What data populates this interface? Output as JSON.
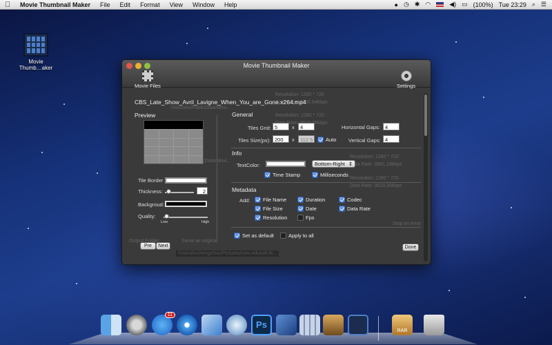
{
  "menubar": {
    "app_name": "Movie Thumbnail Maker",
    "menus": [
      "File",
      "Edit",
      "Format",
      "View",
      "Window",
      "Help"
    ],
    "battery": "(100%)",
    "clock": "Tue 23:29"
  },
  "desktop": {
    "icon_label": "Movie\nThumb…aker"
  },
  "window": {
    "title": "Movie Thumbnail Maker",
    "toolbar": {
      "movie_files": "Movie Files",
      "settings": "Settings"
    },
    "filename": "CBS_Late_Show_Avril_Lavigne_When_You_are_Gone.x264.mp4",
    "preview": {
      "title": "Preview",
      "tile_border": "Tile Border",
      "thickness": "Thickness:",
      "thickness_value": "2",
      "background": "Backgroud:",
      "quality": "Quality:",
      "quality_low": "Low",
      "quality_high": "High"
    },
    "general": {
      "title": "General",
      "tiles_grid_label": "Tiles Grid:",
      "grid_cols": "5",
      "grid_rows": "4",
      "x": "x",
      "tiles_size_label": "Tiles Size(px):",
      "tile_width": "200",
      "tile_height": "112.5",
      "auto": "Auto",
      "horizontal_gaps_label": "Horizontal Gaps:",
      "horizontal_gaps": "4",
      "vertical_gaps_label": "Vertical Gaps:",
      "vertical_gaps": "4"
    },
    "info": {
      "title": "Info",
      "text_color_label": "TextColor:",
      "position": "Bottom-Right",
      "time_stamp": "Time Stamp",
      "milliseconds": "Milliseconds"
    },
    "metadata": {
      "title": "Metadata",
      "add_label": "Add:",
      "items": [
        "File Name",
        "Duration",
        "Codec",
        "File Size",
        "Date",
        "Data Rate",
        "Resolution",
        "Fps"
      ]
    },
    "footer": {
      "set_as_default": "Set as default",
      "apply_to_all": "Apply to all",
      "pre": "Pre",
      "next": "Next",
      "done": "Done"
    },
    "background_text": {
      "res1": "Resolution: 1280 * 720",
      "rate1": "Data Rate: 4930.54kbps",
      "path1": "/Volumes/PublicData/Movi...",
      "res2": "Resolution: 1280 * 720",
      "rate2": "Data Rate: 3815.75kbps",
      "path2": "/Volumes/PublicData/Movi...",
      "res3": "Resolution: 1280 * 720",
      "rate3": "Data Rate: 3981.18kbps",
      "res4": "Resolution: 1280 * 720",
      "rate4": "Data Rate: 3623.36kbps",
      "stop_on_error": "Stop on error",
      "output_folder": "Output Folder:",
      "same_as_original": "Same as original",
      "output_path": "/Users/luchengzhou/Pictures/com.edusoft.M..."
    }
  },
  "dock": {
    "appstore_badge": "11",
    "rar": "RAR"
  }
}
